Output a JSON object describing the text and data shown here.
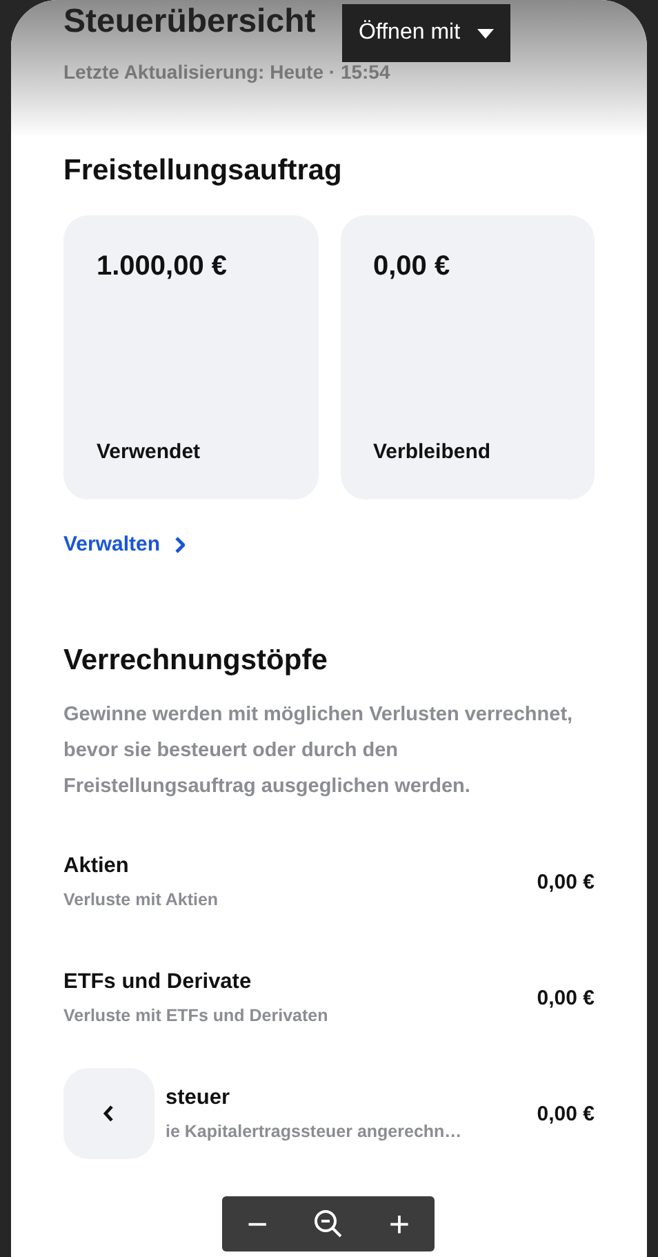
{
  "header": {
    "title": "Steuerübersicht",
    "updated": "Letzte Aktualisierung: Heute · 15:54"
  },
  "viewer": {
    "open_with": "Öffnen mit",
    "zoom_out": "−",
    "zoom_in": "+"
  },
  "allowance": {
    "title": "Freistellungsauftrag",
    "cards": [
      {
        "amount": "1.000,00 €",
        "label": "Verwendet"
      },
      {
        "amount": "0,00 €",
        "label": "Verbleibend"
      }
    ],
    "manage_link": "Verwalten"
  },
  "pots": {
    "title": "Verrechnungstöpfe",
    "description": "Gewinne werden mit möglichen Verlusten verrechnet, bevor sie besteuert oder durch den Freistellungsauftrag ausgeglichen werden.",
    "rows": [
      {
        "title": "Aktien",
        "subtitle": "Verluste mit Aktien",
        "amount": "0,00 €"
      },
      {
        "title": "ETFs und Derivate",
        "subtitle": "Verluste mit ETFs und Derivaten",
        "amount": "0,00 €"
      },
      {
        "title": "steuer",
        "subtitle": "ie Kapitalertragssteuer angerechn…",
        "amount": "0,00 €"
      }
    ]
  }
}
